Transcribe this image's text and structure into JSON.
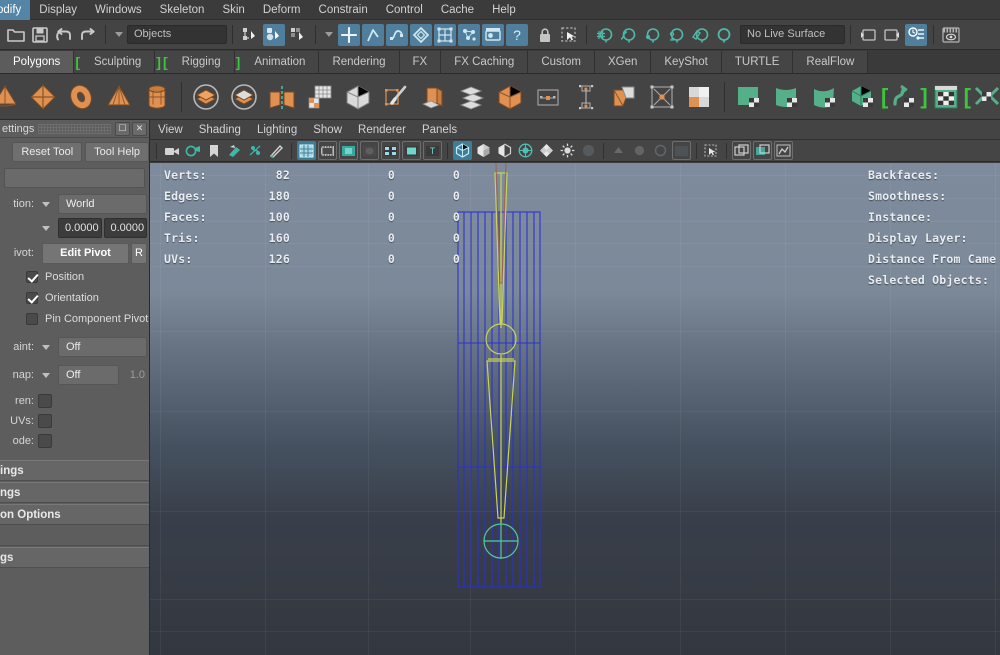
{
  "app": {
    "name": "Autodesk Maya",
    "theme_bg": "#444444",
    "accent": "#4f7f9c",
    "shelf_green": "#3ec43e"
  },
  "menubar": {
    "items": [
      {
        "label": "odify",
        "name": "menu-modify",
        "clipped": true
      },
      {
        "label": "Display",
        "name": "menu-display"
      },
      {
        "label": "Windows",
        "name": "menu-windows"
      },
      {
        "label": "Skeleton",
        "name": "menu-skeleton"
      },
      {
        "label": "Skin",
        "name": "menu-skin"
      },
      {
        "label": "Deform",
        "name": "menu-deform"
      },
      {
        "label": "Constrain",
        "name": "menu-constrain"
      },
      {
        "label": "Control",
        "name": "menu-control"
      },
      {
        "label": "Cache",
        "name": "menu-cache"
      },
      {
        "label": "Help",
        "name": "menu-help"
      }
    ]
  },
  "toolbar": {
    "selection_mask_value": "Objects",
    "live_surface_value": "No Live Surface",
    "icons": [
      {
        "name": "open-scene-icon",
        "glyph": "folder"
      },
      {
        "name": "save-scene-icon",
        "glyph": "floppy"
      },
      {
        "name": "undo-icon",
        "glyph": "undo"
      },
      {
        "name": "redo-icon",
        "glyph": "redo"
      },
      {
        "name": "selection-mask-dropdown",
        "glyph": "caret"
      },
      {
        "name": "select-by-hierarchy-icon",
        "glyph": "hierarchy"
      },
      {
        "name": "select-by-object-type-icon",
        "glyph": "object",
        "active": true
      },
      {
        "name": "select-by-component-type-icon",
        "glyph": "component"
      },
      {
        "name": "mask-handles-icon",
        "glyph": "plus",
        "active": true
      },
      {
        "name": "mask-joints-icon",
        "glyph": "joint",
        "active": true
      },
      {
        "name": "mask-curves-icon",
        "glyph": "curve",
        "active": true
      },
      {
        "name": "mask-surfaces-icon",
        "glyph": "surface",
        "active": true
      },
      {
        "name": "mask-deformers-icon",
        "glyph": "lattice",
        "active": true
      },
      {
        "name": "mask-dynamics-icon",
        "glyph": "particles",
        "active": true
      },
      {
        "name": "mask-rendering-icon",
        "glyph": "render",
        "active": true
      },
      {
        "name": "mask-misc-icon",
        "glyph": "question",
        "active": true
      },
      {
        "name": "lock-selection-icon",
        "glyph": "lock"
      },
      {
        "name": "highlight-selection-icon",
        "glyph": "marquee"
      },
      {
        "name": "snap-to-grid-icon",
        "glyph": "snapgrid"
      },
      {
        "name": "snap-to-curve-icon",
        "glyph": "snapcurve"
      },
      {
        "name": "snap-to-point-icon",
        "glyph": "snappoint"
      },
      {
        "name": "snap-to-projected-center-icon",
        "glyph": "snapproj"
      },
      {
        "name": "snap-to-view-plane-icon",
        "glyph": "snapplane"
      },
      {
        "name": "make-live-icon",
        "glyph": "snaplive"
      },
      {
        "name": "show-hide-editor-left-icon",
        "glyph": "panelleft"
      },
      {
        "name": "show-hide-editor-right-icon",
        "glyph": "panelright"
      },
      {
        "name": "attribute-editor-toggle-icon",
        "glyph": "attreditor",
        "active": true
      },
      {
        "name": "render-view-icon",
        "glyph": "rendereye"
      }
    ]
  },
  "shelf": {
    "tabs": [
      {
        "label": "Polygons",
        "name": "shelf-tab-polygons",
        "selected": true
      },
      {
        "label": "Sculpting",
        "name": "shelf-tab-sculpting",
        "bracket_before": true,
        "bracket_after": true
      },
      {
        "label": "Rigging",
        "name": "shelf-tab-rigging",
        "bracket_before": true,
        "bracket_after": true
      },
      {
        "label": "Animation",
        "name": "shelf-tab-animation"
      },
      {
        "label": "Rendering",
        "name": "shelf-tab-rendering"
      },
      {
        "label": "FX",
        "name": "shelf-tab-fx"
      },
      {
        "label": "FX Caching",
        "name": "shelf-tab-fx-caching"
      },
      {
        "label": "Custom",
        "name": "shelf-tab-custom"
      },
      {
        "label": "XGen",
        "name": "shelf-tab-xgen"
      },
      {
        "label": "KeyShot",
        "name": "shelf-tab-keyshot"
      },
      {
        "label": "TURTLE",
        "name": "shelf-tab-turtle"
      },
      {
        "label": "RealFlow",
        "name": "shelf-tab-realflow"
      }
    ],
    "buttons": [
      {
        "name": "poly-cone-clipped-icon",
        "glyph": "cone",
        "color": "#e09050"
      },
      {
        "name": "poly-sphere-icon",
        "glyph": "sphere",
        "color": "#e09050"
      },
      {
        "name": "poly-torus-icon",
        "glyph": "torus",
        "color": "#e09050"
      },
      {
        "name": "poly-pyramid-icon",
        "glyph": "pyramid",
        "color": "#e09050"
      },
      {
        "name": "poly-cylinder-icon",
        "glyph": "cylinder",
        "color": "#e09050"
      },
      {
        "name": "poly-booleans-union-icon",
        "glyph": "boolunion",
        "color": "#e09050"
      },
      {
        "name": "poly-booleans-difference-icon",
        "glyph": "booldiff",
        "color": "#e09050"
      },
      {
        "name": "poly-mirror-icon",
        "glyph": "mirror",
        "color": "#e09050"
      },
      {
        "name": "poly-multi-cut-grid-icon",
        "glyph": "cutgrid",
        "color": "#e09050"
      },
      {
        "name": "poly-smooth-icon",
        "glyph": "smoothcube",
        "color": "#e09050"
      },
      {
        "name": "poly-quad-draw-icon",
        "glyph": "quaddraw",
        "color": "#e09050"
      },
      {
        "name": "poly-multi-cut-icon",
        "glyph": "multicut",
        "color": "#e09050"
      },
      {
        "name": "poly-extrude-icon",
        "glyph": "extrude",
        "color": "#e09050"
      },
      {
        "name": "poly-bevel-icon",
        "glyph": "bevel",
        "color": "#e09050"
      },
      {
        "name": "poly-combine-icon",
        "glyph": "combine",
        "color": "#e09050"
      },
      {
        "name": "poly-merge-icon",
        "glyph": "merge",
        "color": "#e09050"
      },
      {
        "name": "poly-bridge-icon",
        "glyph": "bridge",
        "color": "#e09050"
      },
      {
        "name": "poly-append-icon",
        "glyph": "append",
        "color": "#e09050"
      },
      {
        "name": "poly-wedge-icon",
        "glyph": "wedge",
        "color": "#e09050"
      },
      {
        "name": "uv-editor-icon",
        "glyph": "uvchecker",
        "color": "#e09050"
      },
      {
        "name": "uv-planar-map-icon",
        "glyph": "uvplanar",
        "color": "#55b08a"
      },
      {
        "name": "uv-cylindrical-map-icon",
        "glyph": "uvcyl",
        "color": "#55b08a"
      },
      {
        "name": "uv-spherical-map-icon",
        "glyph": "uvsph",
        "color": "#55b08a"
      },
      {
        "name": "uv-automatic-map-icon",
        "glyph": "uvauto",
        "color": "#55b08a"
      },
      {
        "name": "uv-unfold-icon",
        "glyph": "uvunfold",
        "color": "#55b08a",
        "bracket_before": true,
        "bracket_after": true
      },
      {
        "name": "uv-editor-window-icon",
        "glyph": "uvwin",
        "color": "#55b08a"
      },
      {
        "name": "uv-layout-icon",
        "glyph": "uvlayout",
        "color": "#55b08a",
        "bracket_before": true,
        "bracket_after": true
      }
    ]
  },
  "tool_settings": {
    "title": "ettings",
    "reset_label": "Reset Tool",
    "help_label": "Tool Help",
    "search_value": "",
    "rows": [
      {
        "name": "axis-orientation-row",
        "label": "tion:",
        "value": "World"
      },
      {
        "name": "axis-offset-row",
        "label": "",
        "value_x": "0.0000",
        "value_y": "0.0000"
      }
    ],
    "pivot": {
      "label": "ivot:",
      "edit_label": "Edit Pivot",
      "reset_label": "R"
    },
    "checkboxes": [
      {
        "name": "pivot-position-checkbox",
        "label": "Position",
        "checked": true
      },
      {
        "name": "pivot-orientation-checkbox",
        "label": "Orientation",
        "checked": true
      },
      {
        "name": "pin-component-pivot-checkbox",
        "label": "Pin Component Pivot",
        "checked": false
      }
    ],
    "paint": {
      "label": "aint:",
      "value": "Off"
    },
    "snap": {
      "label": "nap:",
      "value": "Off",
      "amount": "1.0"
    },
    "toggles": [
      {
        "name": "children-toggle-row",
        "label": "ren:"
      },
      {
        "name": "uvs-toggle-row",
        "label": "UVs:"
      },
      {
        "name": "mode-toggle-row",
        "label": "ode:"
      }
    ],
    "sections": [
      {
        "name": "section-soft-selection",
        "label": "ings"
      },
      {
        "name": "section-symmetry-settings",
        "label": "ngs"
      },
      {
        "name": "section-reflection-options",
        "label": "on Options"
      },
      {
        "name": "section-blank",
        "label": ""
      },
      {
        "name": "section-tool-settings",
        "label": "gs"
      }
    ]
  },
  "viewport": {
    "menus": [
      {
        "label": "View",
        "name": "viewport-menu-view"
      },
      {
        "label": "Shading",
        "name": "viewport-menu-shading"
      },
      {
        "label": "Lighting",
        "name": "viewport-menu-lighting"
      },
      {
        "label": "Show",
        "name": "viewport-menu-show"
      },
      {
        "label": "Renderer",
        "name": "viewport-menu-renderer"
      },
      {
        "label": "Panels",
        "name": "viewport-menu-panels"
      }
    ],
    "tool_icons": [
      {
        "name": "select-camera-icon",
        "glyph": "camera"
      },
      {
        "name": "camera-attributes-icon",
        "glyph": "camattr"
      },
      {
        "name": "bookmark-icon",
        "glyph": "bookmark"
      },
      {
        "name": "image-plane-icon",
        "glyph": "imageplane"
      },
      {
        "name": "two-d-pan-zoom-icon",
        "glyph": "panzoom"
      },
      {
        "name": "grease-pencil-icon",
        "glyph": "pencil"
      },
      {
        "name": "grid-toggle-icon",
        "glyph": "grid",
        "active": true
      },
      {
        "name": "film-gate-icon",
        "glyph": "filmgate"
      },
      {
        "name": "resolution-gate-icon",
        "glyph": "resgate"
      },
      {
        "name": "gate-mask-icon",
        "glyph": "gatemask"
      },
      {
        "name": "field-chart-icon",
        "glyph": "fieldchart"
      },
      {
        "name": "safe-action-icon",
        "glyph": "safeaction"
      },
      {
        "name": "safe-title-icon",
        "glyph": "safetitle"
      },
      {
        "name": "wireframe-shading-icon",
        "glyph": "wire",
        "active": true
      },
      {
        "name": "smooth-shade-all-icon",
        "glyph": "shadeall"
      },
      {
        "name": "smooth-shade-selected-icon",
        "glyph": "shadesel"
      },
      {
        "name": "flat-shade-icon",
        "glyph": "flatshade"
      },
      {
        "name": "shaded-wireframe-icon",
        "glyph": "shadewire"
      },
      {
        "name": "use-default-material-icon",
        "glyph": "defmat"
      },
      {
        "name": "textured-icon",
        "glyph": "textured",
        "dim": true
      },
      {
        "name": "lighting-icon",
        "glyph": "lighting",
        "dim": true
      },
      {
        "name": "shadows-icon",
        "glyph": "shadows",
        "dim": true
      },
      {
        "name": "screen-space-ao-icon",
        "glyph": "ssao",
        "dim": true
      },
      {
        "name": "motion-blur-icon",
        "glyph": "motionblur"
      },
      {
        "name": "isolate-select-icon",
        "glyph": "isolate"
      },
      {
        "name": "xray-icon",
        "glyph": "xray"
      },
      {
        "name": "xray-joints-icon",
        "glyph": "xrayjoints"
      },
      {
        "name": "exposure-icon",
        "glyph": "exposure"
      }
    ],
    "hud_left": {
      "columns": [
        "label",
        "count",
        "a",
        "b"
      ],
      "rows": [
        {
          "label": "Verts:",
          "count": "82",
          "a": "0",
          "b": "0"
        },
        {
          "label": "Edges:",
          "count": "180",
          "a": "0",
          "b": "0"
        },
        {
          "label": "Faces:",
          "count": "100",
          "a": "0",
          "b": "0"
        },
        {
          "label": "Tris:",
          "count": "160",
          "a": "0",
          "b": "0"
        },
        {
          "label": "UVs:",
          "count": "126",
          "a": "0",
          "b": "0"
        }
      ]
    },
    "hud_right": [
      {
        "name": "hud-backfaces",
        "label": "Backfaces:"
      },
      {
        "name": "hud-smoothness",
        "label": "Smoothness:"
      },
      {
        "name": "hud-instance",
        "label": "Instance:"
      },
      {
        "name": "hud-display-layer",
        "label": "Display Layer:"
      },
      {
        "name": "hud-distance-from-camera",
        "label": "Distance From Came"
      },
      {
        "name": "hud-selected-objects",
        "label": "Selected Objects:"
      }
    ],
    "scene": {
      "selected_mesh_color": "#2a30d8",
      "skeleton_color": "#c9d455",
      "mesh_name": "selected-cylinder-wireframe",
      "skeleton_name": "joint-chain"
    }
  }
}
